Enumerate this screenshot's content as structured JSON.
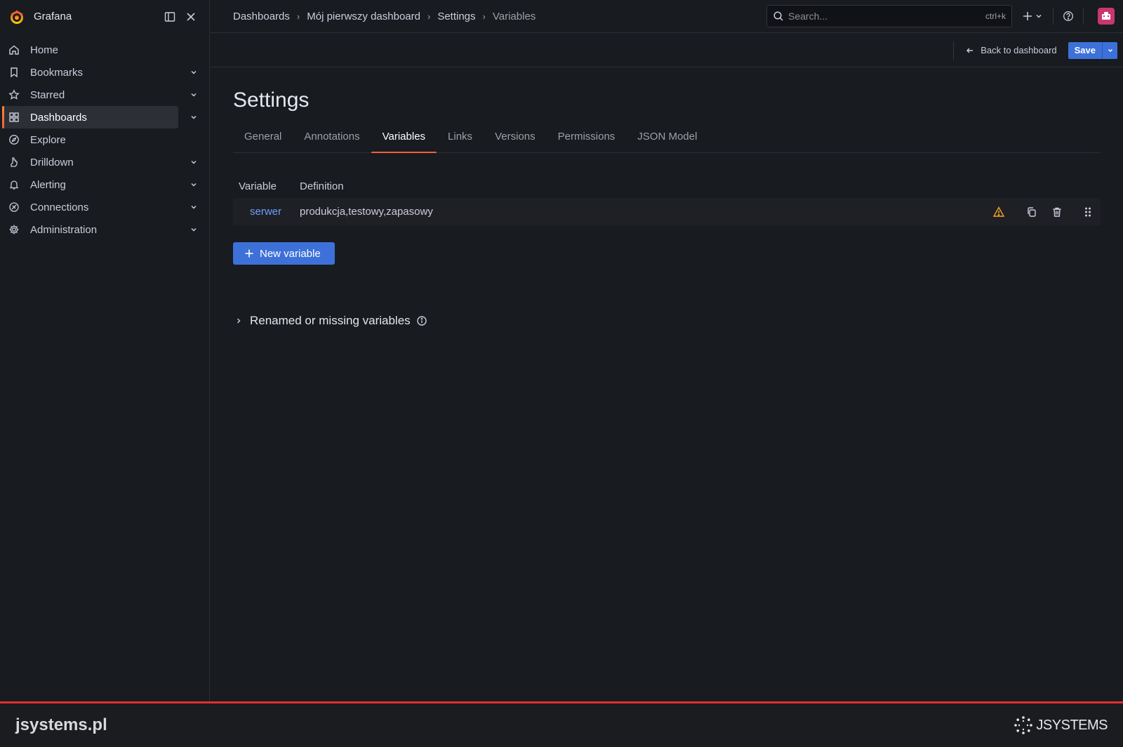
{
  "app": {
    "name": "Grafana"
  },
  "sidebar": {
    "items": [
      {
        "label": "Home",
        "icon": "home-icon",
        "expandable": false,
        "active": false
      },
      {
        "label": "Bookmarks",
        "icon": "bookmark-icon",
        "expandable": true,
        "active": false
      },
      {
        "label": "Starred",
        "icon": "star-icon",
        "expandable": true,
        "active": false
      },
      {
        "label": "Dashboards",
        "icon": "dashboards-grid-icon",
        "expandable": true,
        "active": true
      },
      {
        "label": "Explore",
        "icon": "compass-icon",
        "expandable": false,
        "active": false
      },
      {
        "label": "Drilldown",
        "icon": "drilldown-icon",
        "expandable": true,
        "active": false
      },
      {
        "label": "Alerting",
        "icon": "bell-icon",
        "expandable": true,
        "active": false
      },
      {
        "label": "Connections",
        "icon": "connections-icon",
        "expandable": true,
        "active": false
      },
      {
        "label": "Administration",
        "icon": "gear-icon",
        "expandable": true,
        "active": false
      }
    ]
  },
  "breadcrumbs": [
    "Dashboards",
    "Mój pierwszy dashboard",
    "Settings",
    "Variables"
  ],
  "search": {
    "placeholder": "Search...",
    "shortcut": "ctrl+k"
  },
  "actionbar": {
    "back_label": "Back to dashboard",
    "save_label": "Save"
  },
  "page": {
    "title": "Settings",
    "tabs": [
      "General",
      "Annotations",
      "Variables",
      "Links",
      "Versions",
      "Permissions",
      "JSON Model"
    ],
    "active_tab": "Variables"
  },
  "variables": {
    "headers": {
      "variable": "Variable",
      "definition": "Definition"
    },
    "rows": [
      {
        "name": "serwer",
        "definition": "produkcja,testowy,zapasowy"
      }
    ],
    "new_label": "New variable",
    "renamed_label": "Renamed or missing variables"
  },
  "footer": {
    "site": "jsystems.pl",
    "brand": "JSYSTEMS"
  },
  "colors": {
    "accent_blue": "#3d71d9",
    "link_blue": "#6e9fff",
    "active_orange": "#f55f3e",
    "warning": "#f5a623",
    "footer_red": "#e02f2f"
  }
}
